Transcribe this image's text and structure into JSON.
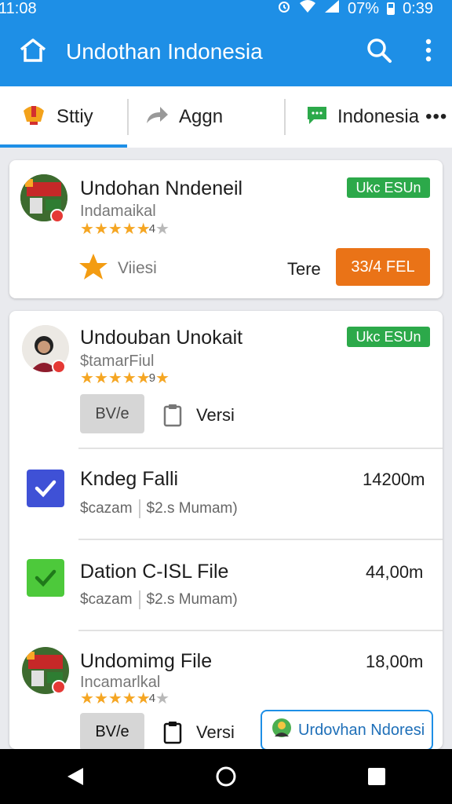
{
  "status_bar": {
    "time_left": "11:08",
    "battery": "07%",
    "time_right": "0:39"
  },
  "appbar": {
    "title": "Undothan Indonesia"
  },
  "tabs": [
    {
      "label": "Sttiy",
      "icon": "badge-icon"
    },
    {
      "label": "Aggn",
      "icon": "share-arrow-icon"
    },
    {
      "label": "Indonesia",
      "icon": "chat-icon",
      "more": "•••"
    }
  ],
  "cards": [
    {
      "name": "Undohan Nndeneil",
      "subtitle": "Indamaikal",
      "rating_text": "4",
      "badge": "Ukc ESUn",
      "fav_label": "Viiesi",
      "action_text": "Tere",
      "action_button": "33/4 FEL"
    },
    {
      "name": "Undouban Unokait",
      "subtitle": "$tamarFiul",
      "rating_text": "9",
      "badge": "Ukc ESUn",
      "gray_button": "BV/e",
      "version_label": "Versi"
    }
  ],
  "files": [
    {
      "name": "Kndeg Falli",
      "size": "14200m",
      "meta_left": "$cazam",
      "meta_right": "$2.s Mumam)",
      "check_color": "#3f51d6"
    },
    {
      "name": "Dation C-ISL File",
      "size": "44,00m",
      "meta_left": "$cazam",
      "meta_right": "$2.s Mumam)",
      "check_color": "#4dc93b"
    }
  ],
  "last_card": {
    "name": "Undomimg File",
    "subtitle": "Incamarlkal",
    "rating_text": "4",
    "size": "18,00m",
    "gray_button": "BV/e",
    "version_label": "Versi",
    "outline_button": "Urdovhan Ndoresi"
  },
  "colors": {
    "primary": "#1e8fe6",
    "accent_orange": "#ea7317",
    "badge_green": "#2ca94a",
    "star": "#f5a623"
  }
}
